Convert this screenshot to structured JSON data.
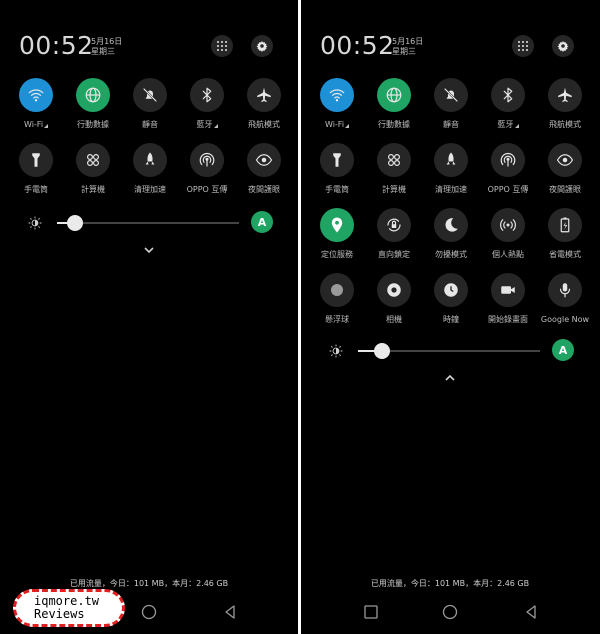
{
  "left_panel": {
    "time": "00:52",
    "date": "5月16日",
    "weekday": "星期三",
    "tiles": [
      {
        "label": "Wi-Fi",
        "icon": "wifi-icon",
        "state": "on-blue",
        "tri": true
      },
      {
        "label": "行動數據",
        "icon": "globe-icon",
        "state": "on-green"
      },
      {
        "label": "靜音",
        "icon": "mute-bell-icon",
        "state": "off"
      },
      {
        "label": "藍牙",
        "icon": "bluetooth-icon",
        "state": "off",
        "tri": true
      },
      {
        "label": "飛航模式",
        "icon": "airplane-icon",
        "state": "off"
      },
      {
        "label": "手電筒",
        "icon": "flashlight-icon",
        "state": "off"
      },
      {
        "label": "計算機",
        "icon": "calculator-icon",
        "state": "off"
      },
      {
        "label": "清理加速",
        "icon": "rocket-icon",
        "state": "off"
      },
      {
        "label": "OPPO 互傳",
        "icon": "share-icon",
        "state": "off"
      },
      {
        "label": "夜間護眼",
        "icon": "eye-icon",
        "state": "off"
      }
    ],
    "brightness": {
      "level": 0.1,
      "auto_label": "A"
    },
    "data_usage": "已用流量，今日：101 MB，本月：2.46 GB"
  },
  "right_panel": {
    "time": "00:52",
    "date": "5月16日",
    "weekday": "星期三",
    "tiles": [
      {
        "label": "Wi-Fi",
        "icon": "wifi-icon",
        "state": "on-blue",
        "tri": true
      },
      {
        "label": "行動數據",
        "icon": "globe-icon",
        "state": "on-green"
      },
      {
        "label": "靜音",
        "icon": "mute-bell-icon",
        "state": "off"
      },
      {
        "label": "藍牙",
        "icon": "bluetooth-icon",
        "state": "off",
        "tri": true
      },
      {
        "label": "飛航模式",
        "icon": "airplane-icon",
        "state": "off"
      },
      {
        "label": "手電筒",
        "icon": "flashlight-icon",
        "state": "off"
      },
      {
        "label": "計算機",
        "icon": "calculator-icon",
        "state": "off"
      },
      {
        "label": "清理加速",
        "icon": "rocket-icon",
        "state": "off"
      },
      {
        "label": "OPPO 互傳",
        "icon": "share-icon",
        "state": "off"
      },
      {
        "label": "夜間護眼",
        "icon": "eye-icon",
        "state": "off"
      },
      {
        "label": "定位服務",
        "icon": "location-icon",
        "state": "on-green"
      },
      {
        "label": "直向鎖定",
        "icon": "rotation-lock-icon",
        "state": "off"
      },
      {
        "label": "勿擾模式",
        "icon": "moon-icon",
        "state": "off"
      },
      {
        "label": "個人熱點",
        "icon": "hotspot-icon",
        "state": "off"
      },
      {
        "label": "省電模式",
        "icon": "battery-icon",
        "state": "off"
      },
      {
        "label": "懸浮球",
        "icon": "float-ball-icon",
        "state": "off"
      },
      {
        "label": "相機",
        "icon": "camera-icon",
        "state": "off"
      },
      {
        "label": "時鐘",
        "icon": "clock-icon",
        "state": "off"
      },
      {
        "label": "開始錄畫面",
        "icon": "video-record-icon",
        "state": "off"
      },
      {
        "label": "Google Now",
        "icon": "mic-icon",
        "state": "off"
      }
    ],
    "brightness": {
      "level": 0.13,
      "auto_label": "A"
    },
    "data_usage": "已用流量，今日：101 MB，本月：2.46 GB"
  },
  "watermark": {
    "line1": "iqmore.tw",
    "line2": "Reviews"
  },
  "colors": {
    "blue": "#1e90d6",
    "green": "#1fa463",
    "tile": "#262626"
  }
}
